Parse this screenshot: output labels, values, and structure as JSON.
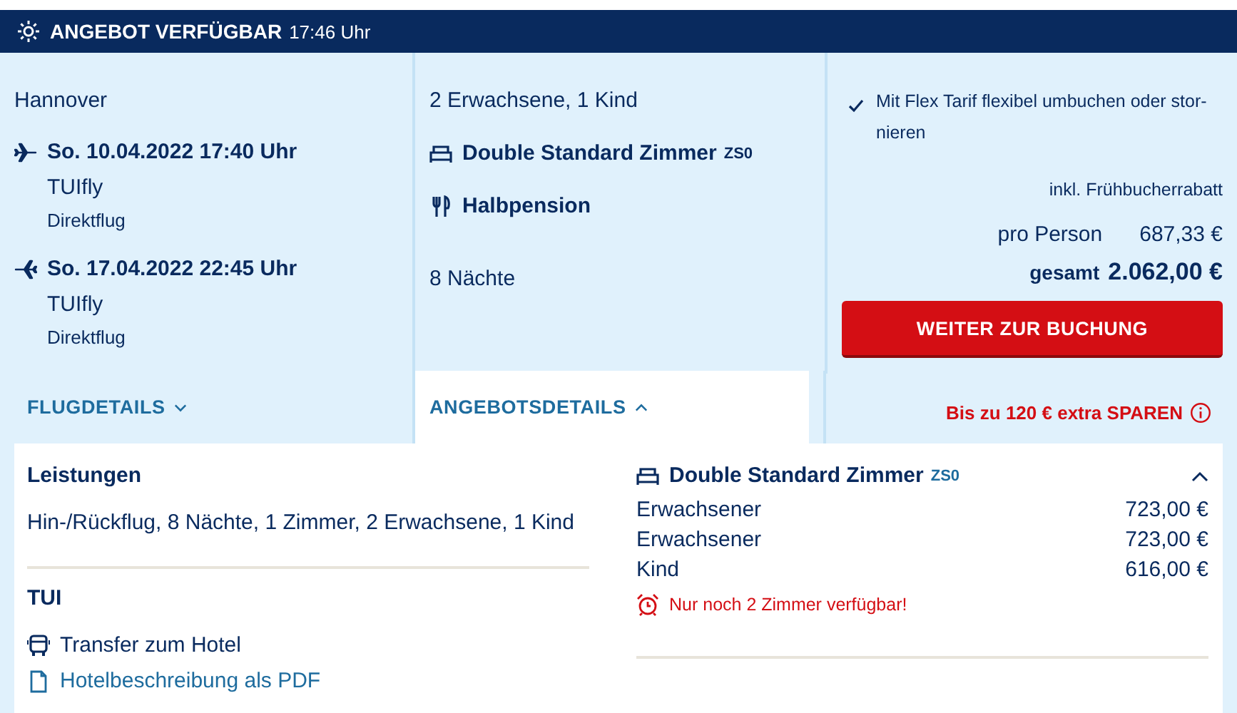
{
  "banner": {
    "title": "ANGEBOT VERFÜGBAR",
    "time": "17:46 Uhr"
  },
  "flights": {
    "departure_airport": "Hannover",
    "legs": [
      {
        "kind": "outbound",
        "datetime": "So. 10.04.2022 17:40 Uhr",
        "airline": "TUIfly",
        "type": "Direktflug"
      },
      {
        "kind": "return",
        "datetime": "So. 17.04.2022 22:45 Uhr",
        "airline": "TUIfly",
        "type": "Direktflug"
      }
    ]
  },
  "offer": {
    "travellers": "2 Erwachsene, 1 Kind",
    "room": "Double Standard Zimmer",
    "room_code": "ZS0",
    "board": "Halbpension",
    "nights": "8 Nächte"
  },
  "tabs": [
    {
      "label": "FLUGDETAILS",
      "selected": false
    },
    {
      "label": "ANGEBOTSDETAILS",
      "selected": true
    }
  ],
  "price": {
    "flex_note": "Mit Flex Tarif flexibel umbuchen oder stor-nieren",
    "discount_note": "inkl. Frühbucherrabatt",
    "per_person_label": "pro Person",
    "per_person": "687,33 €",
    "total_label": "gesamt",
    "total": "2.062,00 €",
    "button": "WEITER ZUR BUCHUNG",
    "savings": "Bis zu 120 € extra SPAREN"
  },
  "details": {
    "services_title": "Leistungen",
    "services": "Hin-/Rückflug, 8 Nächte, 1 Zimmer, 2 Erwachsene, 1 Kind",
    "operator": "TUI",
    "transfer": "Transfer zum Hotel",
    "pdf_link": "Hotelbeschreibung als PDF",
    "room": {
      "name": "Double Standard Zimmer",
      "code": "ZS0",
      "expanded": true,
      "prices": [
        {
          "label": "Erwachsener",
          "amount": "723,00 €"
        },
        {
          "label": "Erwachsener",
          "amount": "723,00 €"
        },
        {
          "label": "Kind",
          "amount": "616,00 €"
        }
      ],
      "availability": "Nur noch 2 Zimmer verfügbar!"
    }
  }
}
